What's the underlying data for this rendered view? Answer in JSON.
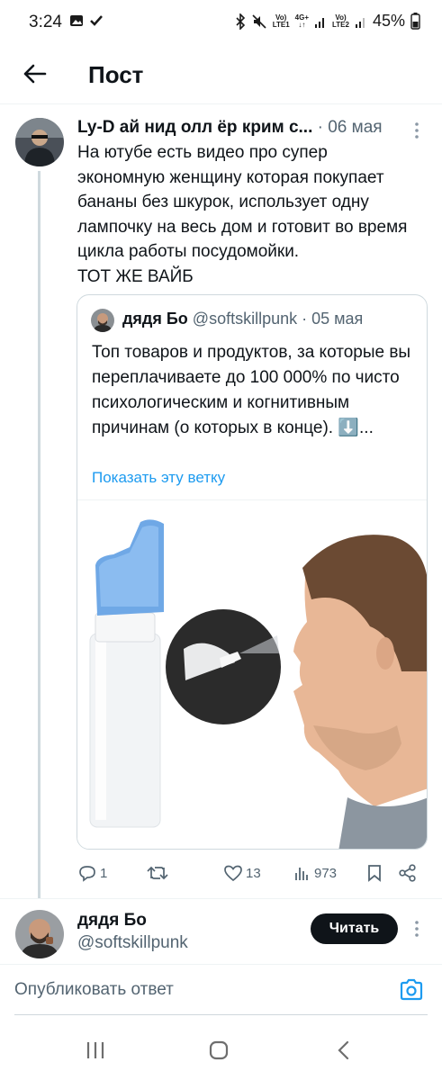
{
  "status_bar": {
    "time": "3:24",
    "lte1": "LTE1",
    "lte2": "LTE2",
    "net1": "Vo)",
    "net2": "4G+",
    "battery": "45%"
  },
  "header": {
    "title": "Пост"
  },
  "post": {
    "author_name": "Ly-D ай нид олл ёр крим с...",
    "date": " · 06 мая",
    "text": "На ютубе есть видео про супер экономную женщину которая покупает бананы без шкурок, использует одну лампочку на весь дом и готовит во время цикла работы посудомойки.\nТОТ ЖЕ ВАЙБ"
  },
  "quote": {
    "author_name": "дядя Бо",
    "handle_date": " @softskillpunk · 05 мая",
    "text": "Топ товаров и продуктов, за которые вы переплачиваете до 100 000% по чисто психологическим и когнитивным причинам (о которых в конце). ⬇️...",
    "show_thread": "Показать эту ветку"
  },
  "actions": {
    "replies": "1",
    "likes": "13",
    "views": "973"
  },
  "author_card": {
    "name": "дядя Бо",
    "handle": "@softskillpunk",
    "follow_label": "Читать"
  },
  "reply": {
    "placeholder": "Опубликовать ответ"
  },
  "colors": {
    "accent": "#1d9bf0",
    "text_primary": "#0f1419",
    "text_secondary": "#536471",
    "follow_button": "#0f1419"
  }
}
